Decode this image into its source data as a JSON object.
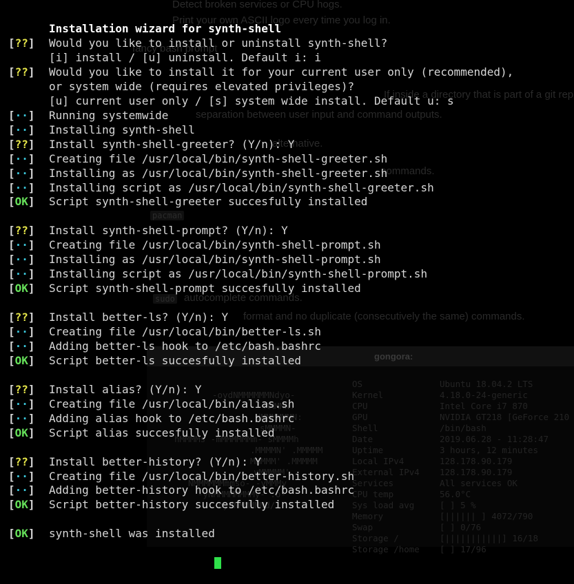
{
  "terminal": {
    "title": "Installation wizard for synth-shell",
    "lines": [
      {
        "tag": "[??]",
        "kind": "ask",
        "text": "Would you like to install or uninstall synth-shell?"
      },
      {
        "tag": "",
        "kind": "none",
        "text": "[i] install / [u] uninstall. Default i: i"
      },
      {
        "tag": "[??]",
        "kind": "ask",
        "text": "Would you like to install it for your current user only (recommended),"
      },
      {
        "tag": "",
        "kind": "none",
        "text": "or system wide (requires elevated privileges)?"
      },
      {
        "tag": "",
        "kind": "none",
        "text": "[u] current user only / [s] system wide install. Default u: s"
      },
      {
        "tag": "[··]",
        "kind": "info",
        "text": "Running systemwide"
      },
      {
        "tag": "[··]",
        "kind": "info",
        "text": "Installing synth-shell"
      },
      {
        "tag": "[??]",
        "kind": "ask",
        "text": "Install synth-shell-greeter? (Y/n): Y"
      },
      {
        "tag": "[··]",
        "kind": "info",
        "text": "Creating file /usr/local/bin/synth-shell-greeter.sh"
      },
      {
        "tag": "[··]",
        "kind": "info",
        "text": "Installing as /usr/local/bin/synth-shell-greeter.sh"
      },
      {
        "tag": "[··]",
        "kind": "info",
        "text": "Installing script as /usr/local/bin/synth-shell-greeter.sh"
      },
      {
        "tag": "[OK]",
        "kind": "ok",
        "text": "Script synth-shell-greeter succesfully installed"
      },
      {
        "tag": "",
        "kind": "none",
        "text": ""
      },
      {
        "tag": "[??]",
        "kind": "ask",
        "text": "Install synth-shell-prompt? (Y/n): Y"
      },
      {
        "tag": "[··]",
        "kind": "info",
        "text": "Creating file /usr/local/bin/synth-shell-prompt.sh"
      },
      {
        "tag": "[··]",
        "kind": "info",
        "text": "Installing as /usr/local/bin/synth-shell-prompt.sh"
      },
      {
        "tag": "[··]",
        "kind": "info",
        "text": "Installing script as /usr/local/bin/synth-shell-prompt.sh"
      },
      {
        "tag": "[OK]",
        "kind": "ok",
        "text": "Script synth-shell-prompt succesfully installed"
      },
      {
        "tag": "",
        "kind": "none",
        "text": ""
      },
      {
        "tag": "[??]",
        "kind": "ask",
        "text": "Install better-ls? (Y/n): Y"
      },
      {
        "tag": "[··]",
        "kind": "info",
        "text": "Creating file /usr/local/bin/better-ls.sh"
      },
      {
        "tag": "[··]",
        "kind": "info",
        "text": "Adding better-ls hook to /etc/bash.bashrc"
      },
      {
        "tag": "[OK]",
        "kind": "ok",
        "text": "Script better-ls succesfully installed"
      },
      {
        "tag": "",
        "kind": "none",
        "text": ""
      },
      {
        "tag": "[??]",
        "kind": "ask",
        "text": "Install alias? (Y/n): Y"
      },
      {
        "tag": "[··]",
        "kind": "info",
        "text": "Creating file /usr/local/bin/alias.sh"
      },
      {
        "tag": "[··]",
        "kind": "info",
        "text": "Adding alias hook to /etc/bash.bashrc"
      },
      {
        "tag": "[OK]",
        "kind": "ok",
        "text": "Script alias succesfully installed"
      },
      {
        "tag": "",
        "kind": "none",
        "text": ""
      },
      {
        "tag": "[??]",
        "kind": "ask",
        "text": "Install better-history? (Y/n): Y"
      },
      {
        "tag": "[··]",
        "kind": "info",
        "text": "Creating file /usr/local/bin/better-history.sh"
      },
      {
        "tag": "[··]",
        "kind": "info",
        "text": "Adding better-history hook to /etc/bash.bashrc"
      },
      {
        "tag": "[OK]",
        "kind": "ok",
        "text": "Script better-history succesfully installed"
      },
      {
        "tag": "",
        "kind": "none",
        "text": ""
      },
      {
        "tag": "[OK]",
        "kind": "ok",
        "text": "synth-shell was installed"
      }
    ]
  },
  "background_doc": {
    "lines": [
      "Detect broken services or CPU hogs.",
      "Print your own ASCII logo every time you log in.",
      "fancy bash prompt",
      "separation between user input and command outputs.",
      "If inside a directory that is part of a git rep",
      "alternative.",
      "commands.",
      "pacman",
      "autocomplete commands.",
      "format and no duplicate (consecutively the same) commands."
    ],
    "code_pills": [
      "pacman",
      "sudo"
    ]
  },
  "background_window": {
    "title": "gongora:",
    "info_rows": [
      {
        "key": "OS",
        "value": "Ubuntu 18.04.2 LTS"
      },
      {
        "key": "Kernel",
        "value": "4.18.0-24-generic"
      },
      {
        "key": "CPU",
        "value": "Intel Core i7 870"
      },
      {
        "key": "GPU",
        "value": "NVIDIA GT218 [GeForce 210"
      },
      {
        "key": "Shell",
        "value": "/bin/bash"
      },
      {
        "key": "Date",
        "value": "2019.06.28 - 11:28:47"
      },
      {
        "key": "Uptime",
        "value": "3 hours, 12 minutes"
      },
      {
        "key": "Local IPv4",
        "value": "128.178.90.179"
      },
      {
        "key": "External IPv4",
        "value": "128.178.90.179"
      },
      {
        "key": "Services",
        "value": "All services OK"
      },
      {
        "key": "CPU temp",
        "value": "56.0°C"
      },
      {
        "key": "Sys load avg",
        "value": "[          ]   5 %"
      },
      {
        "key": "Memory",
        "value": "[||||||     ]  4072/790"
      },
      {
        "key": "Swap",
        "value": "[           ]    0/76"
      },
      {
        "key": "Storage /",
        "value": "[|||||||||||]   16/18"
      },
      {
        "key": "Storage /home",
        "value": "[           ]   17/96"
      }
    ],
    "logo_lines": [
      "-oydNMMMMMMNdyo-",
      "MMMMN.",
      "dMMMMMMN:",
      "sMMMMN-",
      "hMMMMs   -mMMMMMMm-   sMMMMh",
      ".MMMMN'  .MMMMM",
      "MMMMM'   .MMMMM",
      "yMMMMM'",
      "NMMMMMMmmso-  -yMMMy",
      "-yNMMMMMMMMy-   .o-",
      "-oydNMMMMNd/"
    ]
  }
}
